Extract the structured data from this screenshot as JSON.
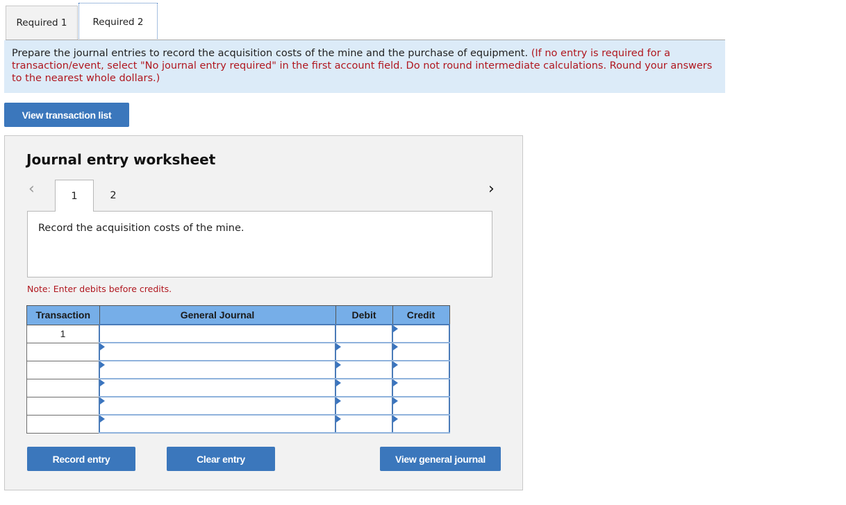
{
  "tabs": [
    {
      "label": "Required 1",
      "active": false
    },
    {
      "label": "Required 2",
      "active": true
    }
  ],
  "instructions": {
    "main": "Prepare the journal entries to record the acquisition costs of the mine and the purchase of equipment. ",
    "note": "(If no entry is required for a transaction/event, select \"No journal entry required\" in the first account field. Do not round intermediate calculations. Round your answers to the nearest whole dollars.)"
  },
  "buttons": {
    "view_transaction_list": "View transaction list",
    "record_entry": "Record entry",
    "clear_entry": "Clear entry",
    "view_general_journal": "View general journal"
  },
  "worksheet": {
    "title": "Journal entry worksheet",
    "nav_prev": "<",
    "nav_next": ">",
    "pages": [
      "1",
      "2"
    ],
    "current_page": "1",
    "description": "Record the acquisition costs of the mine.",
    "note": "Note: Enter debits before credits.",
    "table": {
      "headers": [
        "Transaction",
        "General Journal",
        "Debit",
        "Credit"
      ],
      "rows": [
        {
          "transaction": "1",
          "account": "",
          "debit": "",
          "credit": ""
        },
        {
          "transaction": "",
          "account": "",
          "debit": "",
          "credit": ""
        },
        {
          "transaction": "",
          "account": "",
          "debit": "",
          "credit": ""
        },
        {
          "transaction": "",
          "account": "",
          "debit": "",
          "credit": ""
        },
        {
          "transaction": "",
          "account": "",
          "debit": "",
          "credit": ""
        },
        {
          "transaction": "",
          "account": "",
          "debit": "",
          "credit": ""
        }
      ]
    }
  },
  "colors": {
    "accent": "#3b77bc",
    "header_blue": "#76aee8",
    "instruction_bg": "#dcebf8",
    "warning_red": "#b0171f"
  }
}
